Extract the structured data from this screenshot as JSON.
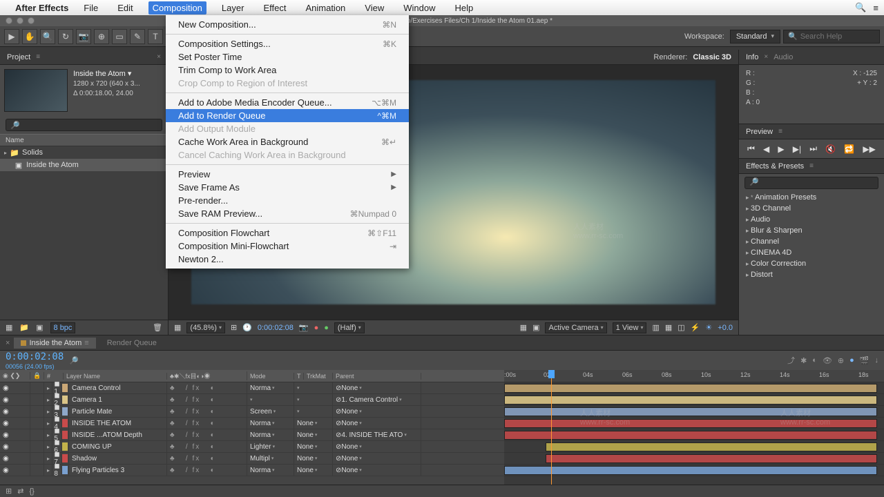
{
  "menubar": {
    "app": "After Effects",
    "items": [
      "File",
      "Edit",
      "Composition",
      "Layer",
      "Effect",
      "Animation",
      "View",
      "Window",
      "Help"
    ],
    "open_index": 2
  },
  "window_title": "ding/Desktop/Exercises Files/Ch 1/Inside the Atom 01.aep *",
  "toolbar": {
    "workspace_label": "Workspace:",
    "workspace_value": "Standard",
    "search_placeholder": "Search Help"
  },
  "composition_menu": [
    {
      "label": "New Composition...",
      "shortcut": "⌘N"
    },
    {
      "sep": true
    },
    {
      "label": "Composition Settings...",
      "shortcut": "⌘K"
    },
    {
      "label": "Set Poster Time"
    },
    {
      "label": "Trim Comp to Work Area"
    },
    {
      "label": "Crop Comp to Region of Interest",
      "disabled": true
    },
    {
      "sep": true
    },
    {
      "label": "Add to Adobe Media Encoder Queue...",
      "shortcut": "⌥⌘M"
    },
    {
      "label": "Add to Render Queue",
      "shortcut": "^⌘M",
      "hover": true
    },
    {
      "label": "Add Output Module",
      "disabled": true
    },
    {
      "label": "Cache Work Area in Background",
      "shortcut": "⌘↵"
    },
    {
      "label": "Cancel Caching Work Area in Background",
      "disabled": true
    },
    {
      "sep": true
    },
    {
      "label": "Preview",
      "submenu": true
    },
    {
      "label": "Save Frame As",
      "submenu": true
    },
    {
      "label": "Pre-render..."
    },
    {
      "label": "Save RAM Preview...",
      "shortcut": "⌘Numpad 0"
    },
    {
      "sep": true
    },
    {
      "label": "Composition Flowchart",
      "shortcut": "⌘⇧F11"
    },
    {
      "label": "Composition Mini-Flowchart",
      "shortcut": "⇥"
    },
    {
      "label": "Newton 2..."
    }
  ],
  "project": {
    "title": "Project",
    "comp_name": "Inside the Atom ▾",
    "line2": "1280 x 720 (640 x 3...",
    "line3": "Δ 0:00:18.00, 24.00",
    "name_col": "Name",
    "items": [
      {
        "icon": "folder",
        "label": "Solids"
      },
      {
        "icon": "comp",
        "label": "Inside the Atom"
      }
    ],
    "bpc": "8 bpc"
  },
  "viewer": {
    "renderer_label": "Renderer:",
    "renderer_value": "Classic 3D",
    "zoom": "(45.8%)",
    "timecode": "0:00:02:08",
    "res": "(Half)",
    "camera": "Active Camera",
    "views": "1 View",
    "exposure": "+0.0"
  },
  "info": {
    "title": "Info",
    "audio_tab": "Audio",
    "R": "R :",
    "G": "G :",
    "B": "B :",
    "A": "A : 0",
    "X": "X : -125",
    "Y": "Y : 2"
  },
  "preview": {
    "title": "Preview"
  },
  "effects": {
    "title": "Effects & Presets",
    "items": [
      "Animation Presets",
      "3D Channel",
      "Audio",
      "Blur & Sharpen",
      "Channel",
      "CINEMA 4D",
      "Color Correction",
      "Distort"
    ]
  },
  "timeline": {
    "tab1": "Inside the Atom",
    "tab2": "Render Queue",
    "timecode": "0:00:02:08",
    "fps": "00056 (24.00 fps)",
    "cols": {
      "layer": "Layer Name",
      "switches": "♣✱＼fx目◐◑◉",
      "mode": "Mode",
      "t": "T",
      "trk": "TrkMat",
      "parent": "Parent"
    },
    "ruler": [
      ":00s",
      "02s",
      "04s",
      "06s",
      "08s",
      "10s",
      "12s",
      "14s",
      "16s",
      "18s"
    ],
    "layers": [
      {
        "n": "1",
        "c": "#caa776",
        "name": "Camera Control",
        "mode": "Norma",
        "trk": "",
        "parent": "None"
      },
      {
        "n": "2",
        "c": "#d9c487",
        "name": "Camera 1",
        "mode": "",
        "trk": "",
        "parent": "1. Camera Control"
      },
      {
        "n": "3",
        "c": "#8fa8c9",
        "name": "Particle Mate",
        "mode": "Screen",
        "trk": "",
        "parent": "None"
      },
      {
        "n": "4",
        "c": "#c84b4b",
        "name": "INSIDE THE ATOM",
        "mode": "Norma",
        "trk": "None",
        "parent": "None"
      },
      {
        "n": "5",
        "c": "#c84b4b",
        "name": "INSIDE ...ATOM Depth",
        "mode": "Norma",
        "trk": "None",
        "parent": "4. INSIDE THE ATO"
      },
      {
        "n": "6",
        "c": "#c2b24b",
        "name": "COMING UP",
        "mode": "Lighter",
        "trk": "None",
        "parent": "None"
      },
      {
        "n": "7",
        "c": "#c84b4b",
        "name": "Shadow",
        "mode": "Multipl",
        "trk": "None",
        "parent": "None"
      },
      {
        "n": "8",
        "c": "#7aa0cf",
        "name": "Flying Particles 3",
        "mode": "Norma",
        "trk": "None",
        "parent": "None"
      }
    ]
  },
  "watermarks": {
    "a": "人人素材",
    "b": "www.rr-sc.com"
  }
}
